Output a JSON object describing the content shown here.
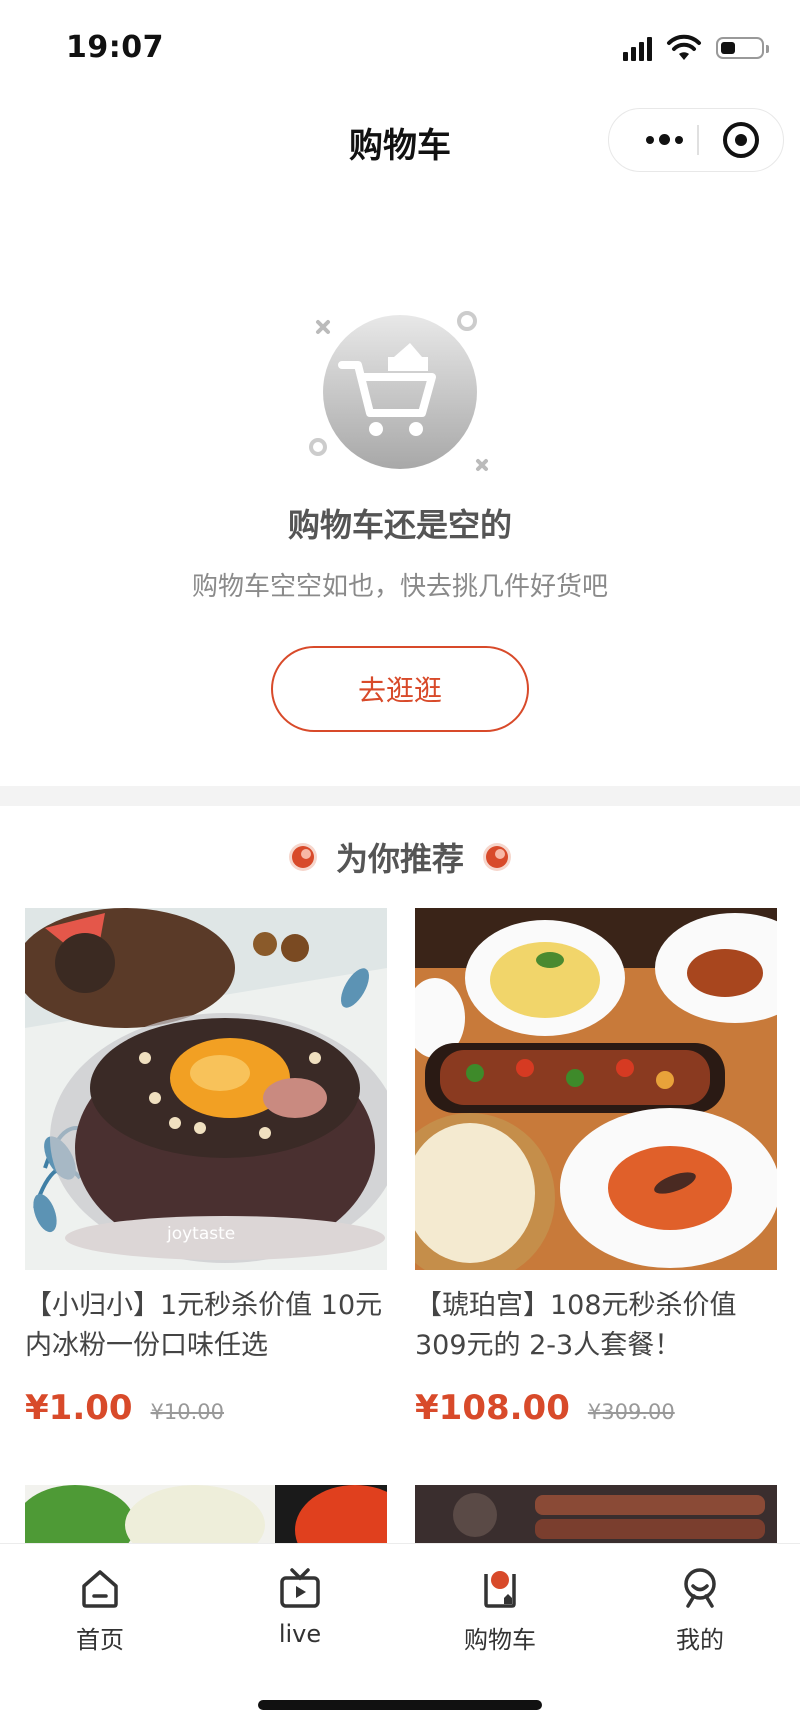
{
  "status_bar": {
    "time": "19:07"
  },
  "nav": {
    "title": "购物车"
  },
  "capsule": {
    "more_icon": "ellipsis-icon",
    "close_icon": "target-close-icon"
  },
  "empty_state": {
    "icon": "empty-cart-icon",
    "title": "购物车还是空的",
    "subtitle": "购物车空空如也，快去挑几件好货吧",
    "button_label": "去逛逛"
  },
  "recommend": {
    "title": "为你推荐",
    "items": [
      {
        "name": "【小归小】1元秒杀价值 10元内冰粉一份口味任选",
        "price": "¥1.00",
        "original_price": "¥10.00",
        "watermark": "joytaste"
      },
      {
        "name": "【琥珀宫】108元秒杀价值309元的 2-3人套餐！",
        "price": "¥108.00",
        "original_price": "¥309.00"
      }
    ]
  },
  "tabbar": {
    "items": [
      {
        "label": "首页",
        "icon": "home-icon"
      },
      {
        "label": "live",
        "icon": "tv-icon"
      },
      {
        "label": "购物车",
        "icon": "cart-icon",
        "active": true
      },
      {
        "label": "我的",
        "icon": "profile-icon"
      }
    ]
  },
  "colors": {
    "accent": "#d84a2a",
    "text_primary": "#111111",
    "text_secondary": "#8a8a8a"
  }
}
